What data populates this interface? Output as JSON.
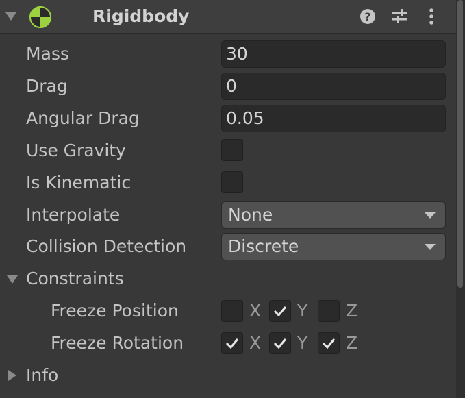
{
  "component": {
    "title": "Rigidbody",
    "icon": "rigidbody-icon",
    "header_icons": [
      "help-icon",
      "presets-icon",
      "more-options-icon"
    ],
    "icon_colors": {
      "green": "#9bd23f",
      "dark": "#2b2b2b"
    }
  },
  "fields": {
    "mass": {
      "label": "Mass",
      "value": "30"
    },
    "drag": {
      "label": "Drag",
      "value": "0"
    },
    "angular_drag": {
      "label": "Angular Drag",
      "value": "0.05"
    },
    "use_gravity": {
      "label": "Use Gravity",
      "checked": false
    },
    "is_kinematic": {
      "label": "Is Kinematic",
      "checked": false
    },
    "interpolate": {
      "label": "Interpolate",
      "value": "None"
    },
    "collision_detection": {
      "label": "Collision Detection",
      "value": "Discrete"
    }
  },
  "constraints": {
    "label": "Constraints",
    "expanded": true,
    "freeze_position": {
      "label": "Freeze Position",
      "x": {
        "axis": "X",
        "checked": false
      },
      "y": {
        "axis": "Y",
        "checked": true
      },
      "z": {
        "axis": "Z",
        "checked": false
      }
    },
    "freeze_rotation": {
      "label": "Freeze Rotation",
      "x": {
        "axis": "X",
        "checked": true
      },
      "y": {
        "axis": "Y",
        "checked": true
      },
      "z": {
        "axis": "Z",
        "checked": true
      }
    }
  },
  "info": {
    "label": "Info",
    "expanded": false
  }
}
